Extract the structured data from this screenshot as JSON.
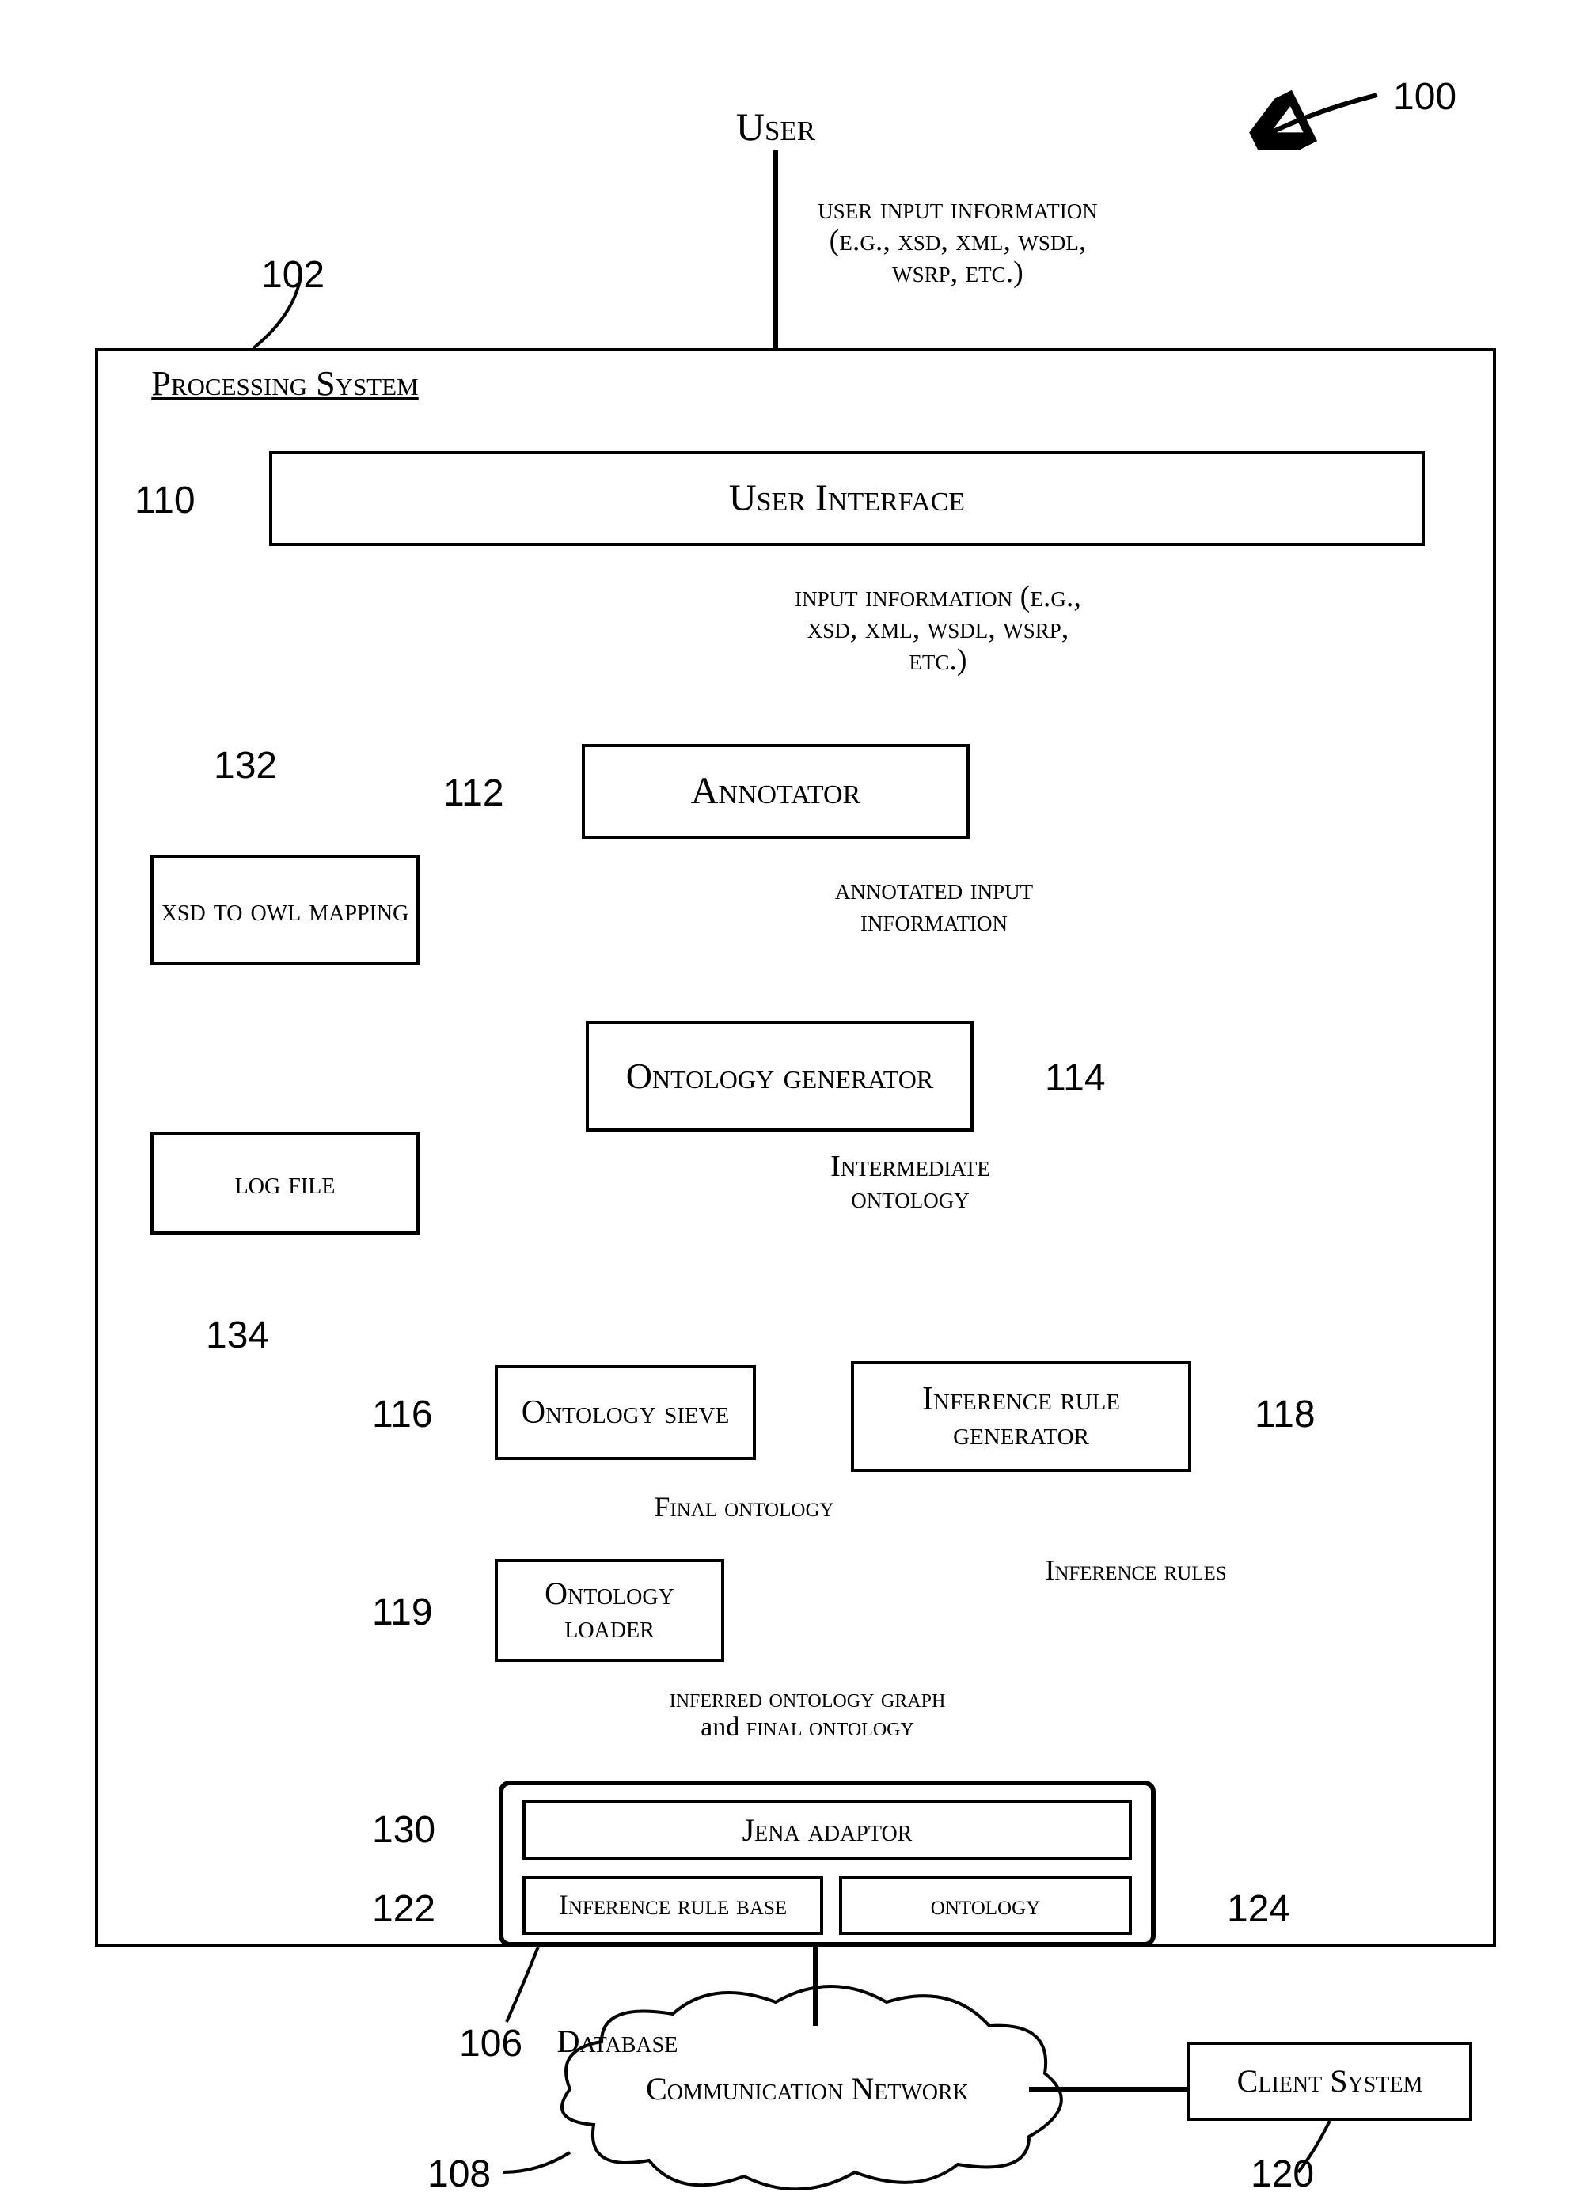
{
  "refs": {
    "r100": "100",
    "r102": "102",
    "r106": "106",
    "r108": "108",
    "r110": "110",
    "r112": "112",
    "r114": "114",
    "r116": "116",
    "r118": "118",
    "r119": "119",
    "r120": "120",
    "r122": "122",
    "r124": "124",
    "r130": "130",
    "r132": "132",
    "r134": "134"
  },
  "texts": {
    "user": "User",
    "user_input": "user input information (e.g., xsd, xml, wsdl, wsrp, etc.)",
    "processing_system": "Processing System",
    "user_interface": "User Interface",
    "input_info": "input information (e.g., xsd, xml, wsdl, wsrp, etc.)",
    "annotator": "Annotator",
    "annotated_input": "annotated input information",
    "ontology_generator": "Ontology generator",
    "xsd_to_owl": "xsd to owl mapping",
    "log_file": "log file",
    "intermediate_ontology": "Intermediate ontology",
    "ontology_sieve": "Ontology sieve",
    "inference_rule_generator": "Inference rule generator",
    "final_ontology": "Final ontology",
    "ontology_loader": "Ontology loader",
    "inference_rules": "Inference rules",
    "inferred_graph": "inferred ontology graph and final ontology",
    "jena_adaptor": "Jena adaptor",
    "inference_rule_base": "Inference rule base",
    "ontology": "ontology",
    "database": "Database",
    "communication_network": "Communication Network",
    "client_system": "Client System"
  }
}
